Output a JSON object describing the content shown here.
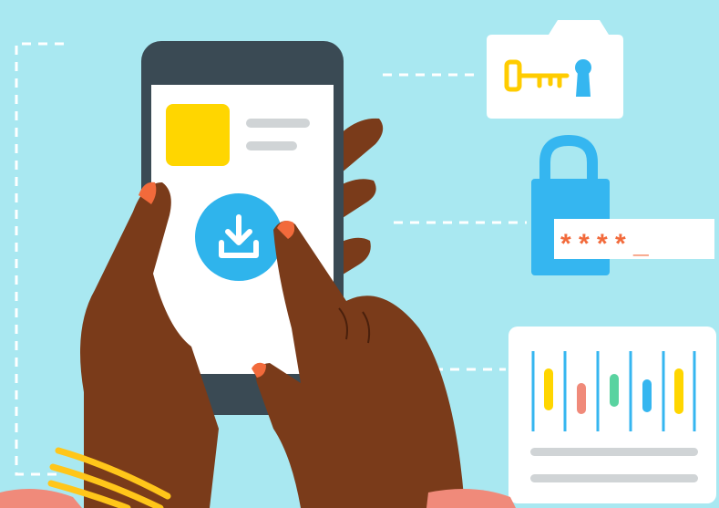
{
  "illustration": {
    "colors": {
      "background": "#a9e8f1",
      "phone_body": "#3a4a54",
      "phone_screen": "#ffffff",
      "card_yellow": "#ffd600",
      "download_button": "#2fb4ec",
      "skin": "#7a3b1a",
      "nail": "#f26a3b",
      "bracelet": "#ffc61a",
      "lock_blue": "#35b6f0",
      "key_yellow": "#ffcc00",
      "dashed_line": "#ffffff",
      "gray_line": "#d0d4d6"
    },
    "phone": {
      "icon": "download-icon"
    },
    "key_card": {
      "icons": [
        "key-icon",
        "keyhole-icon"
      ]
    },
    "password_card": {
      "icon": "padlock-icon",
      "masked_password": "* * * * _"
    },
    "chart_card": {
      "bar_colors": [
        "#ffd600",
        "#f08a7a",
        "#59d3a0",
        "#35b6f0",
        "#ffd600"
      ]
    }
  }
}
